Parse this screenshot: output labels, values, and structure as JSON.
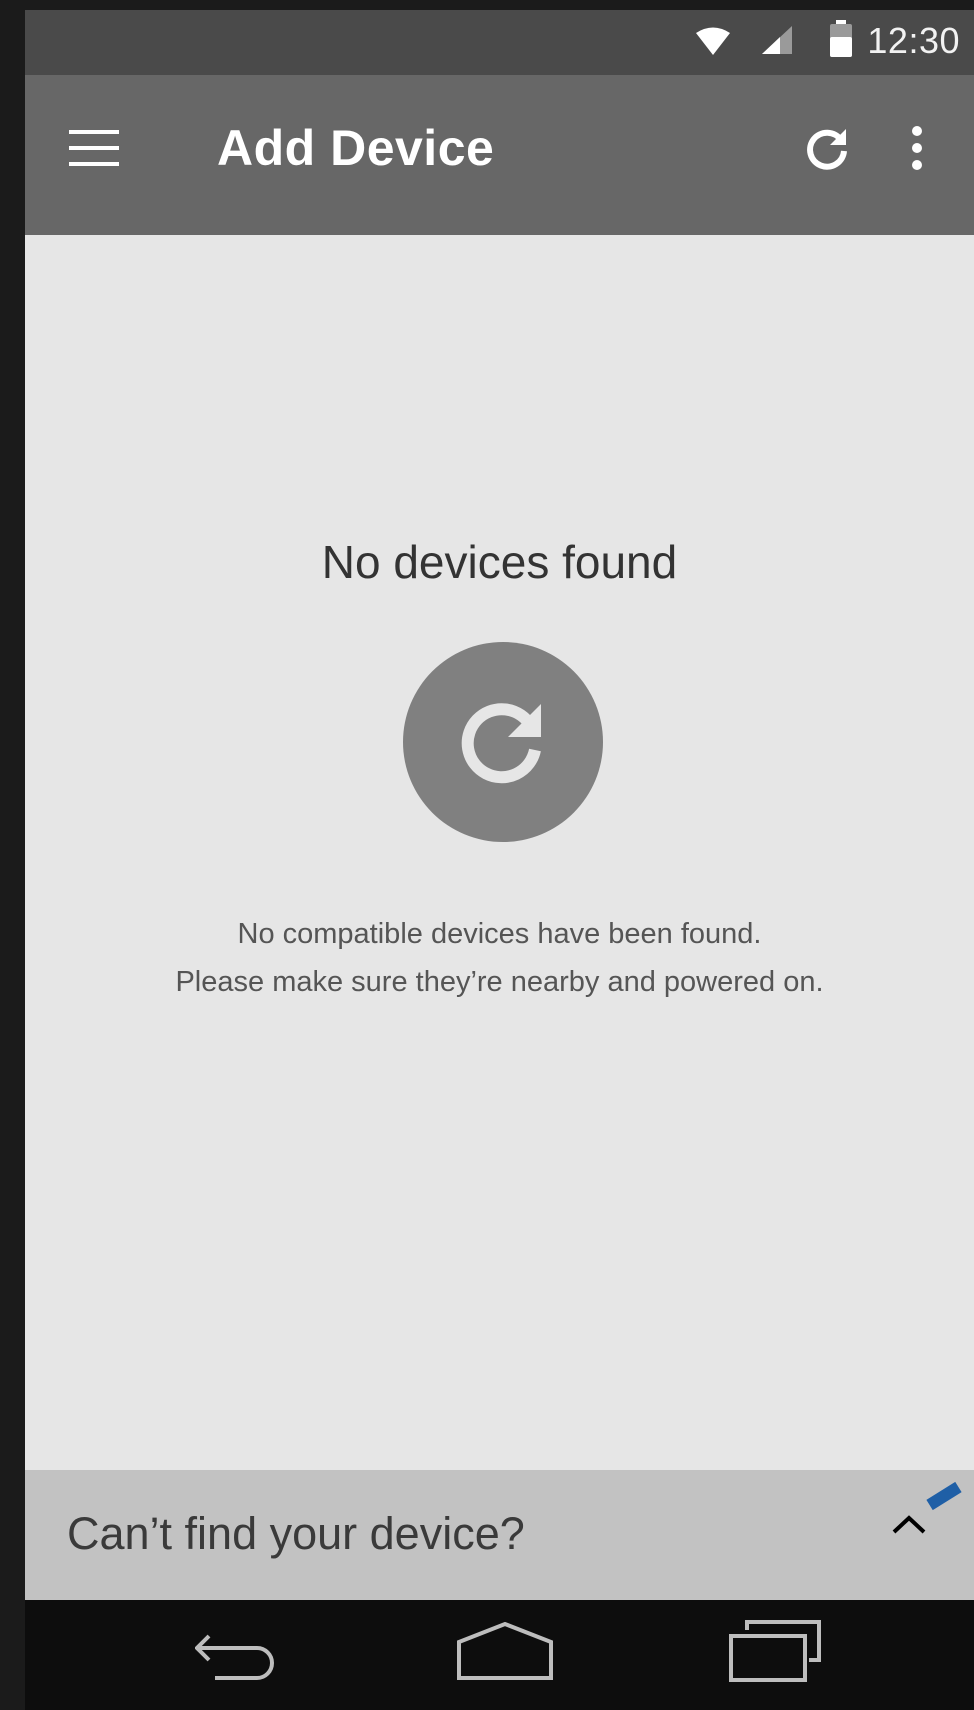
{
  "status_bar": {
    "time": "12:30",
    "icons": [
      "wifi-icon",
      "cell-signal-icon",
      "battery-icon"
    ]
  },
  "app_bar": {
    "title": "Add Device",
    "icons": [
      "hamburger-menu-icon",
      "refresh-icon",
      "overflow-menu-icon"
    ]
  },
  "empty_state": {
    "title": "No devices found",
    "line1": "No compatible devices have been found.",
    "line2": "Please make sure they’re nearby and powered on.",
    "icon": "refresh-icon"
  },
  "bottom_sheet": {
    "label": "Can’t find your device?",
    "icon": "chevron-up-icon"
  },
  "nav_bar": {
    "icons": [
      "back-icon",
      "home-icon",
      "recents-icon"
    ]
  },
  "colors": {
    "status_bar": "#4a4a4a",
    "app_bar": "#676767",
    "content_bg": "#e6e6e6",
    "refresh_circle": "#808080",
    "bottom_sheet": "#c2c2c2",
    "nav_bar": "#0d0d0d",
    "accent": "#1f5fa6"
  }
}
